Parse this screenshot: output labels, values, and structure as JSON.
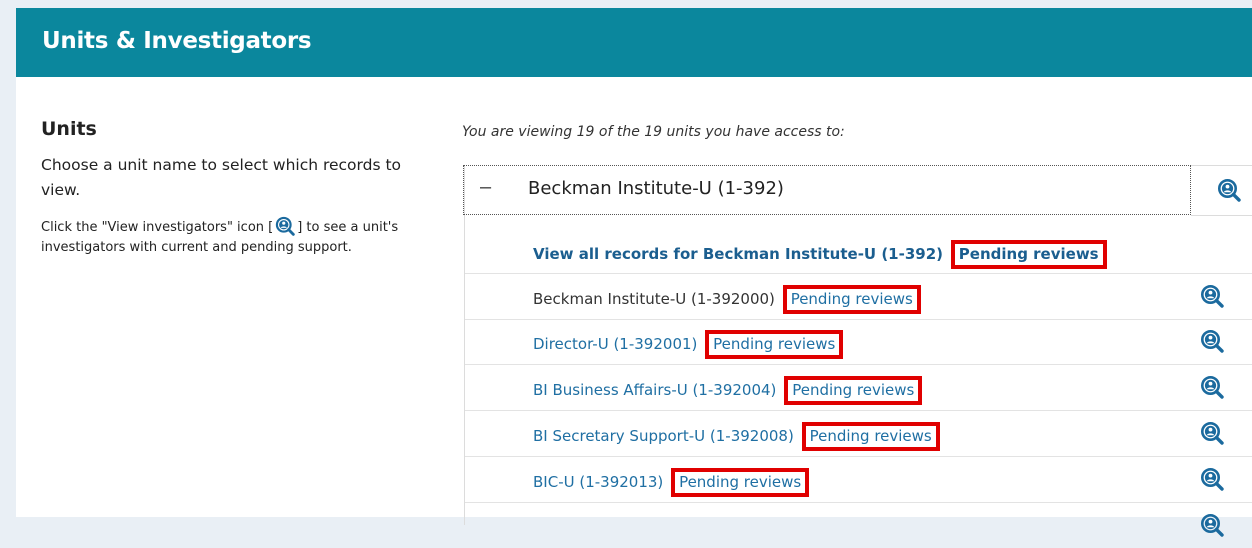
{
  "header": {
    "title": "Units & Investigators"
  },
  "left": {
    "heading": "Units",
    "choose_text": "Choose a unit name to select which records to view.",
    "click_text_before": "Click the \"View investigators\" icon [",
    "click_text_after": "] to see a unit's investigators with current and pending support."
  },
  "main": {
    "intro": "You are viewing 19 of the 19 units you have access to:",
    "parent_unit": {
      "toggle": "–",
      "name": "Beckman Institute-U (1-392)"
    },
    "view_all": {
      "label": "View all records for Beckman Institute-U (1-392)",
      "pending": "Pending reviews"
    },
    "units": [
      {
        "name": "Beckman Institute-U (1-392000)",
        "pending": "Pending reviews"
      },
      {
        "name": "Director-U (1-392001)",
        "pending": "Pending reviews"
      },
      {
        "name": "BI Business Affairs-U (1-392004)",
        "pending": "Pending reviews"
      },
      {
        "name": "BI Secretary Support-U (1-392008)",
        "pending": "Pending reviews"
      },
      {
        "name": "BIC-U (1-392013)",
        "pending": "Pending reviews"
      }
    ]
  },
  "icons": {
    "view_investigators": "view-investigators-icon"
  },
  "colors": {
    "header_bg": "#0b879d",
    "link": "#1f6fa3",
    "highlight_border": "#e00000"
  }
}
